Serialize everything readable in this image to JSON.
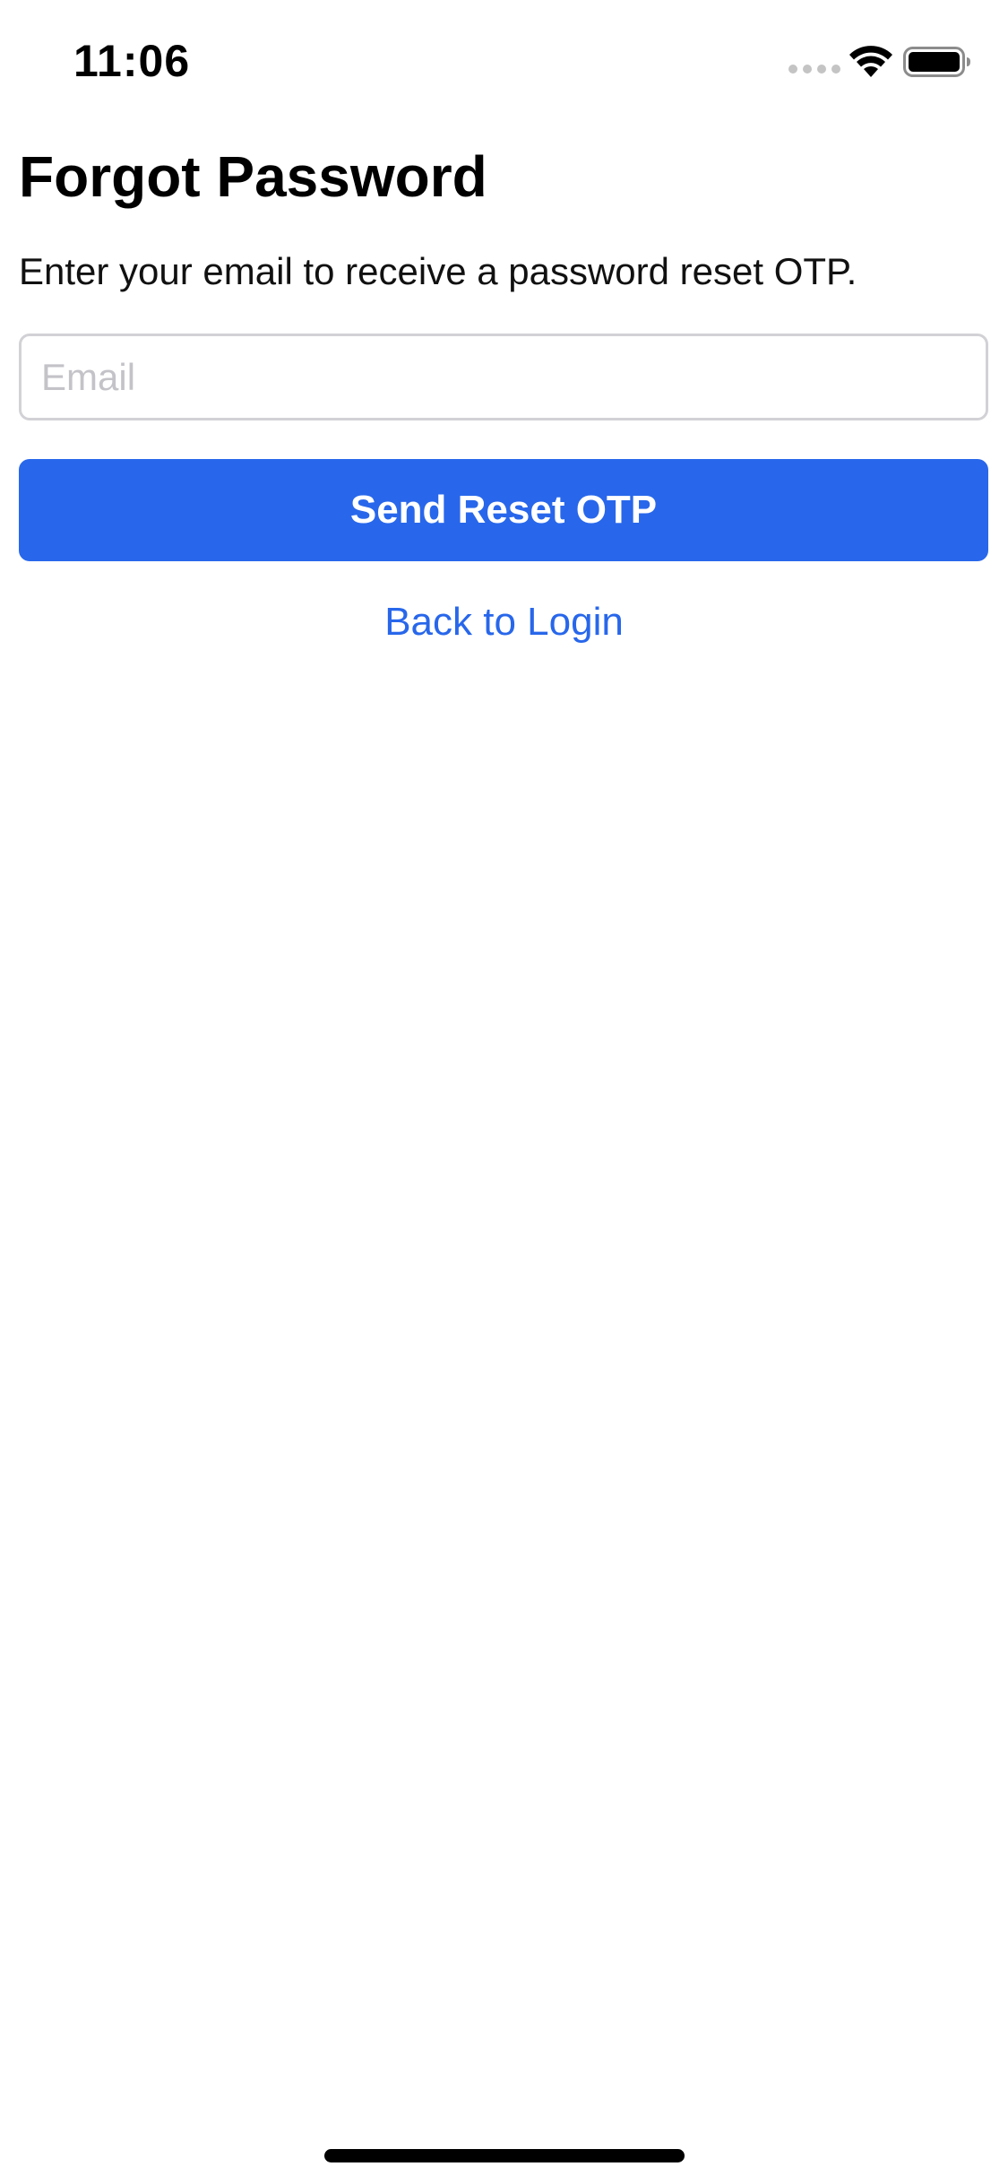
{
  "status_bar": {
    "time": "11:06",
    "icons": [
      "signal-icon",
      "wifi-icon",
      "battery-icon"
    ]
  },
  "screen": {
    "title": "Forgot Password",
    "subtitle": "Enter your email to receive a password reset OTP.",
    "email_input": {
      "value": "",
      "placeholder": "Email"
    },
    "send_button_label": "Send Reset OTP",
    "back_link_label": "Back to Login"
  },
  "colors": {
    "accent": "#2867eb",
    "placeholder": "#c3c3c8",
    "input_border": "#d2d2d6",
    "background": "#ffffff"
  }
}
